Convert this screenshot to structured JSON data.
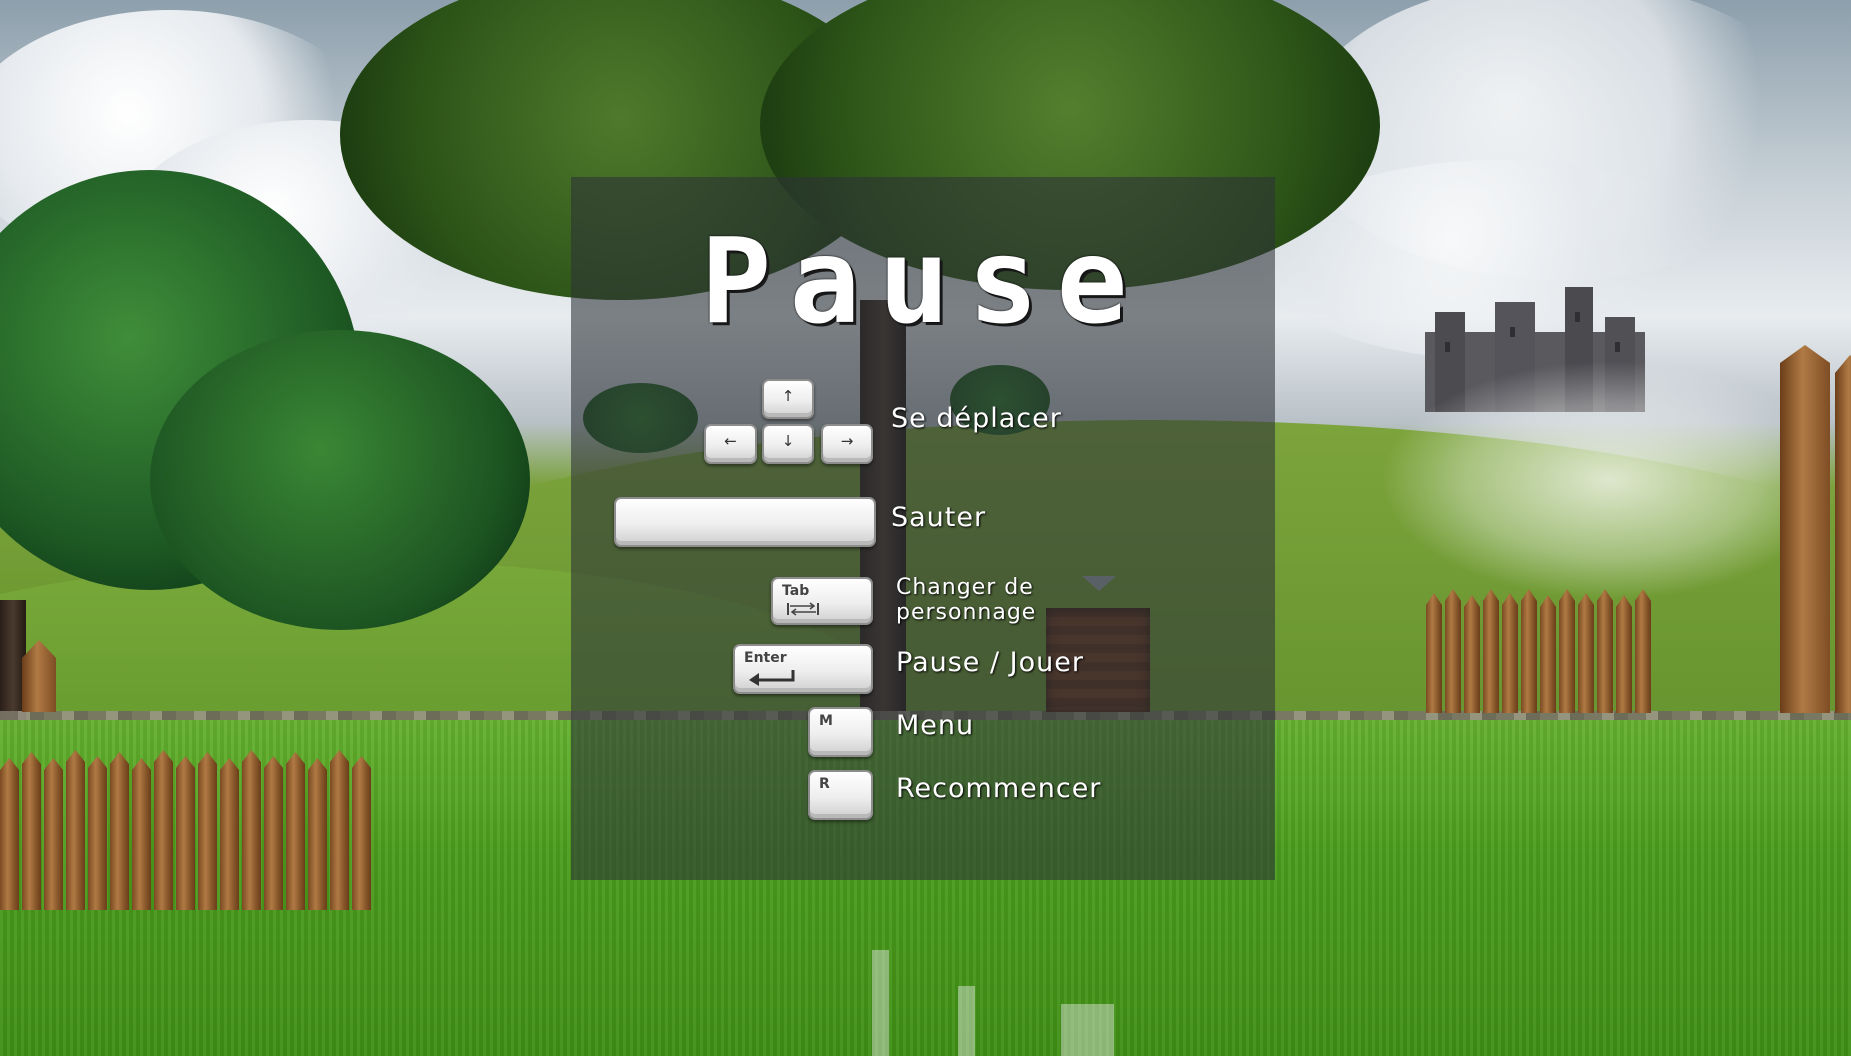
{
  "pause_menu": {
    "title": "Pause",
    "controls": [
      {
        "action": "Se déplacer",
        "keys": [
          "↑",
          "←",
          "↓",
          "→"
        ]
      },
      {
        "action": "Sauter",
        "keys": [
          "space"
        ]
      },
      {
        "action": "Changer de personnage",
        "key_label": "Tab"
      },
      {
        "action": "Pause / Jouer",
        "key_label": "Enter"
      },
      {
        "action": "Menu",
        "key_label": "M"
      },
      {
        "action": "Recommencer",
        "key_label": "R"
      }
    ]
  },
  "colors": {
    "overlay": "#2d3237",
    "text": "#ffffff",
    "key_face": "#eeeeee"
  },
  "icons": [
    "arrow-up-key-icon",
    "arrow-left-key-icon",
    "arrow-down-key-icon",
    "arrow-right-key-icon",
    "spacebar-key-icon",
    "tab-key-icon",
    "enter-key-icon",
    "m-key-icon",
    "r-key-icon"
  ]
}
